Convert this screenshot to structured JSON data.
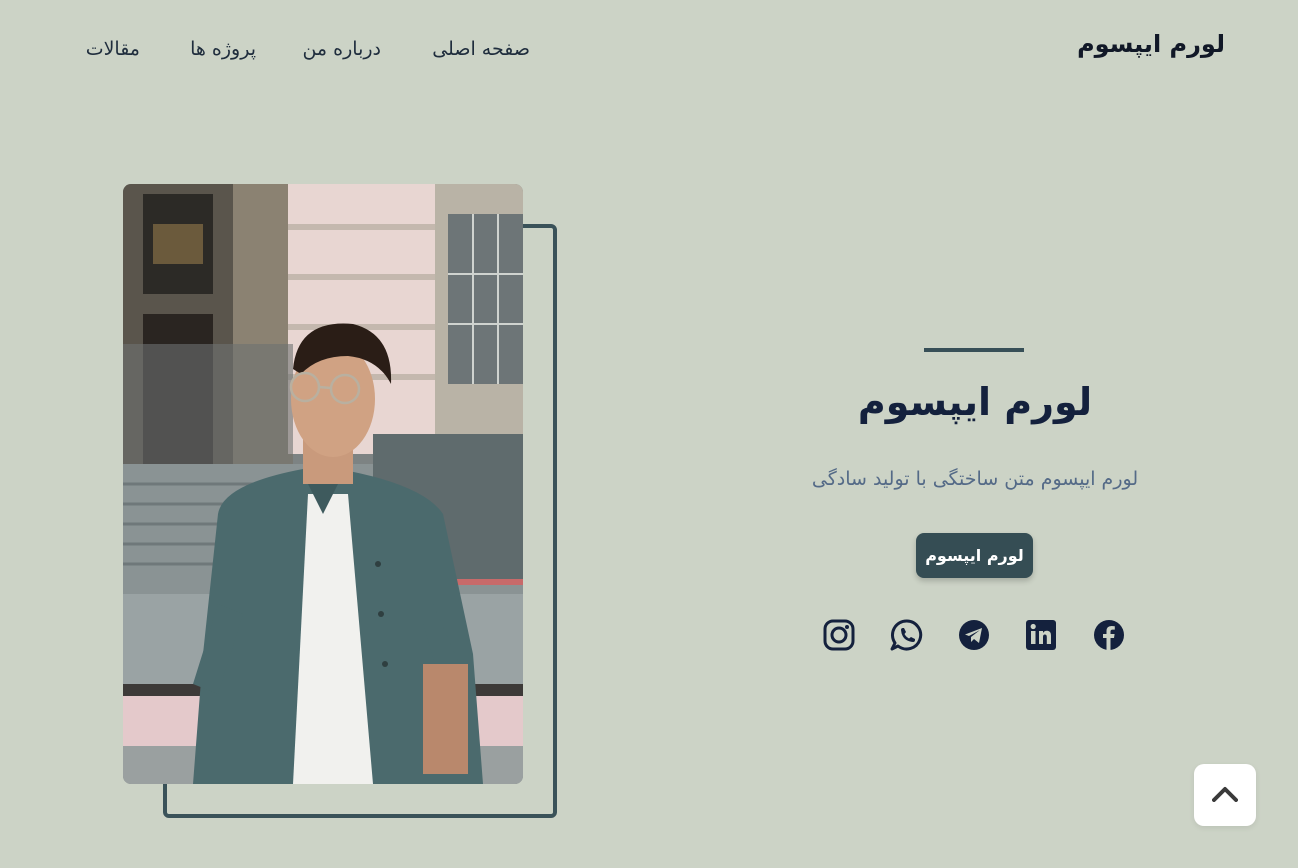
{
  "header": {
    "brand": "لورم ایپسوم",
    "nav": {
      "home": "صفحه اصلی",
      "about": "درباره من",
      "projects": "پروژه ها",
      "articles": "مقالات"
    }
  },
  "hero": {
    "title": "لورم ایپسوم",
    "subtitle": "لورم ایپسوم متن ساختگی با تولید سادگی",
    "button_label": "لورم ایپسوم"
  },
  "socials": [
    "instagram-icon",
    "whatsapp-icon",
    "telegram-icon",
    "linkedin-icon",
    "facebook-icon"
  ],
  "colors": {
    "background": "#ccd3c6",
    "accent": "#354d54",
    "title": "#14213d",
    "subtitle": "#546a87"
  },
  "back_to_top_icon": "chevron-up-icon"
}
